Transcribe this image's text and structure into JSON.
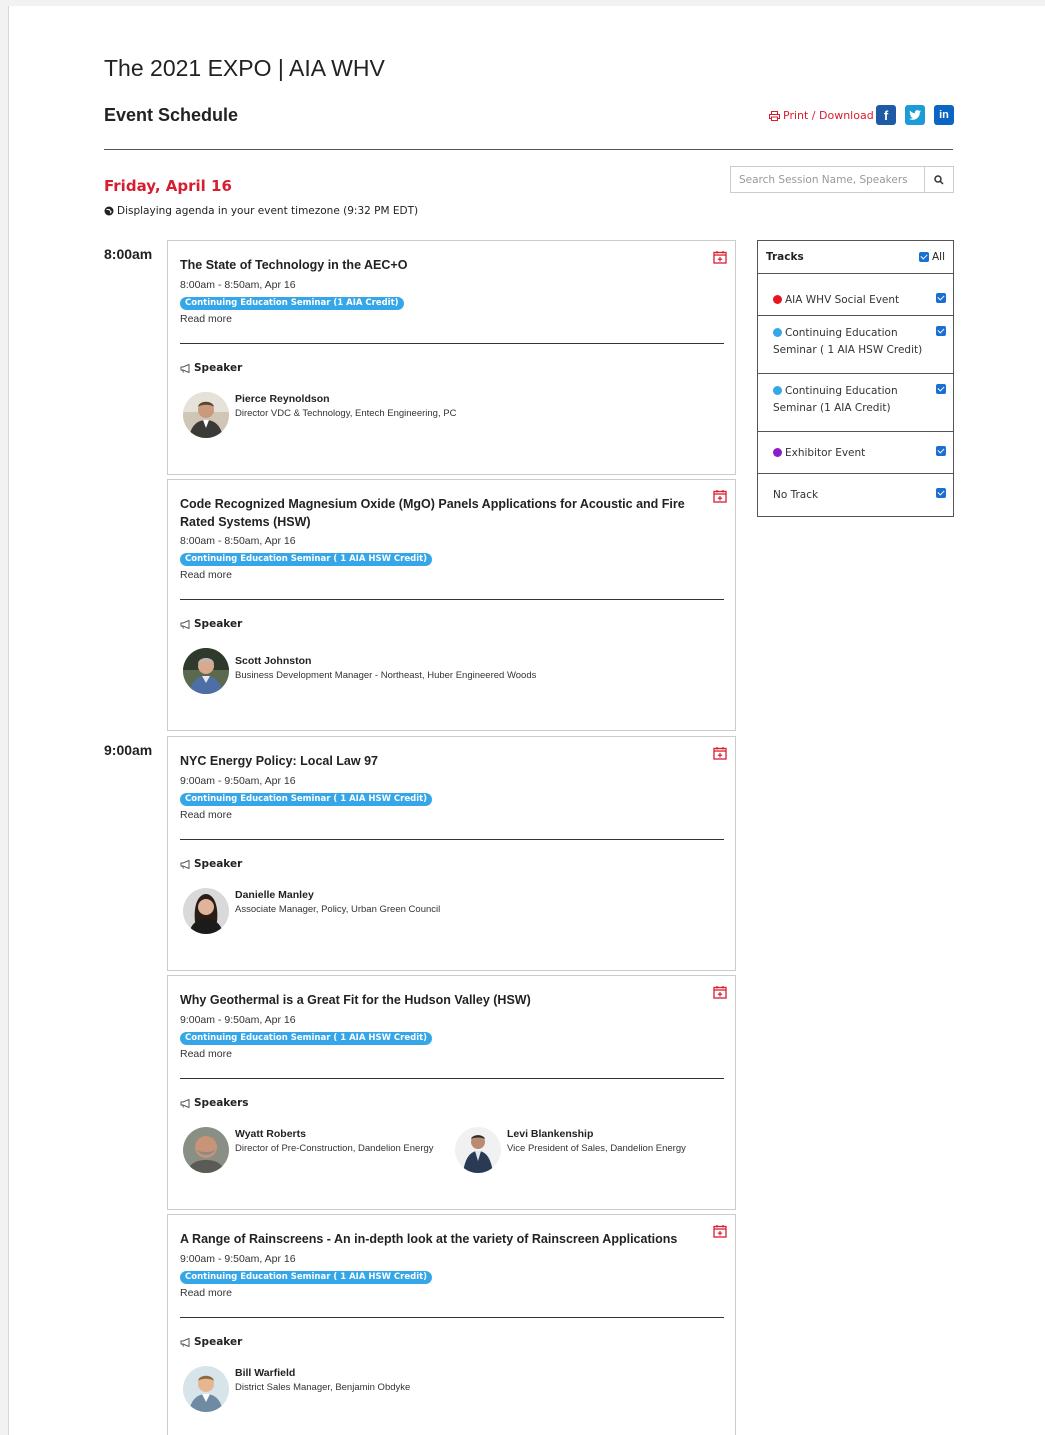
{
  "header": {
    "site_title": "The 2021 EXPO | AIA WHV",
    "schedule_title": "Event Schedule",
    "print_label": "Print / Download"
  },
  "day": {
    "label": "Friday, April 16",
    "timezone_note": "Displaying agenda in your event timezone (9:32 PM EDT)"
  },
  "search": {
    "placeholder": "Search Session Name, Speakers"
  },
  "times": [
    "8:00am",
    "9:00am"
  ],
  "sessions": [
    {
      "title": "The State of Technology in the AEC+O",
      "when": "8:00am - 8:50am, Apr 16",
      "badge": "Continuing Education Seminar (1 AIA Credit)",
      "read_more": "Read more",
      "speaker_heading": "Speaker",
      "speakers": [
        {
          "name": "Pierce Reynoldson",
          "role": "Director VDC & Technology, Entech Engineering, PC"
        }
      ]
    },
    {
      "title": "Code Recognized Magnesium Oxide (MgO) Panels Applications for Acoustic and Fire Rated Systems (HSW)",
      "when": "8:00am - 8:50am, Apr 16",
      "badge": "Continuing Education Seminar ( 1 AIA HSW Credit)",
      "read_more": "Read more",
      "speaker_heading": "Speaker",
      "speakers": [
        {
          "name": "Scott Johnston",
          "role": "Business Development Manager - Northeast, Huber Engineered Woods"
        }
      ]
    },
    {
      "title": "NYC Energy Policy: Local Law 97",
      "when": "9:00am - 9:50am, Apr 16",
      "badge": "Continuing Education Seminar ( 1 AIA HSW Credit)",
      "read_more": "Read more",
      "speaker_heading": "Speaker",
      "speakers": [
        {
          "name": "Danielle Manley",
          "role": "Associate Manager, Policy, Urban Green Council"
        }
      ]
    },
    {
      "title": "Why Geothermal is a Great Fit for the Hudson Valley (HSW)",
      "when": "9:00am - 9:50am, Apr 16",
      "badge": "Continuing Education Seminar ( 1 AIA HSW Credit)",
      "read_more": "Read more",
      "speaker_heading": "Speakers",
      "speakers": [
        {
          "name": "Wyatt Roberts",
          "role": "Director of Pre-Construction, Dandelion Energy"
        },
        {
          "name": "Levi Blankenship",
          "role": "Vice President of Sales, Dandelion Energy"
        }
      ]
    },
    {
      "title": "A Range of Rainscreens - An in-depth look at the variety of Rainscreen Applications",
      "when": "9:00am - 9:50am, Apr 16",
      "badge": "Continuing Education Seminar ( 1 AIA HSW Credit)",
      "read_more": "Read more",
      "speaker_heading": "Speaker",
      "speakers": [
        {
          "name": "Bill Warfield",
          "role": "District Sales Manager, Benjamin Obdyke"
        }
      ]
    }
  ],
  "tracks": {
    "heading": "Tracks",
    "all_label": "All",
    "items": [
      {
        "label": "AIA WHV Social Event",
        "color": "#e8141f"
      },
      {
        "label": "Continuing Education Seminar ( 1 AIA HSW Credit)",
        "color": "#35a7e8"
      },
      {
        "label": "Continuing Education Seminar (1 AIA Credit)",
        "color": "#35a7e8"
      },
      {
        "label": "Exhibitor Event",
        "color": "#8b1cc7"
      },
      {
        "label": "No Track",
        "color": ""
      }
    ]
  },
  "colors": {
    "accent": "#d71d30",
    "badge": "#35a7e8",
    "checkbox": "#1a6fd1"
  }
}
